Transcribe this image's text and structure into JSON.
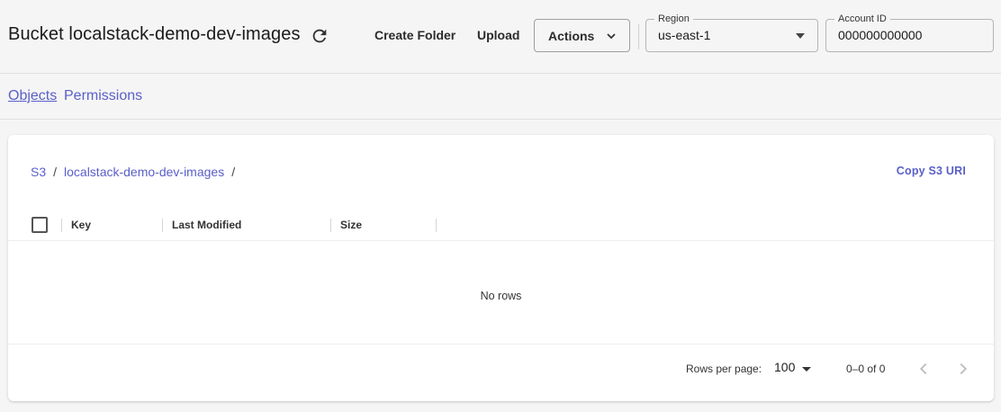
{
  "header": {
    "title": "Bucket localstack-demo-dev-images",
    "refresh_icon": "refresh-icon",
    "create_folder_label": "Create Folder",
    "upload_label": "Upload",
    "actions_label": "Actions",
    "region": {
      "label": "Region",
      "value": "us-east-1"
    },
    "account": {
      "label": "Account ID",
      "value": "000000000000"
    }
  },
  "tabs": [
    {
      "label": "Objects",
      "active": true
    },
    {
      "label": "Permissions",
      "active": false
    }
  ],
  "breadcrumb": {
    "items": [
      "S3",
      "localstack-demo-dev-images"
    ],
    "separator": "/"
  },
  "copy_uri_label": "Copy S3 URI",
  "table": {
    "columns": [
      "Key",
      "Last Modified",
      "Size"
    ],
    "empty_text": "No rows"
  },
  "pagination": {
    "rows_per_page_label": "Rows per page:",
    "rows_per_page_value": "100",
    "range_text": "0–0 of 0"
  },
  "colors": {
    "accent": "#5a5fc8",
    "background": "#f5f5f5",
    "card": "#ffffff"
  }
}
